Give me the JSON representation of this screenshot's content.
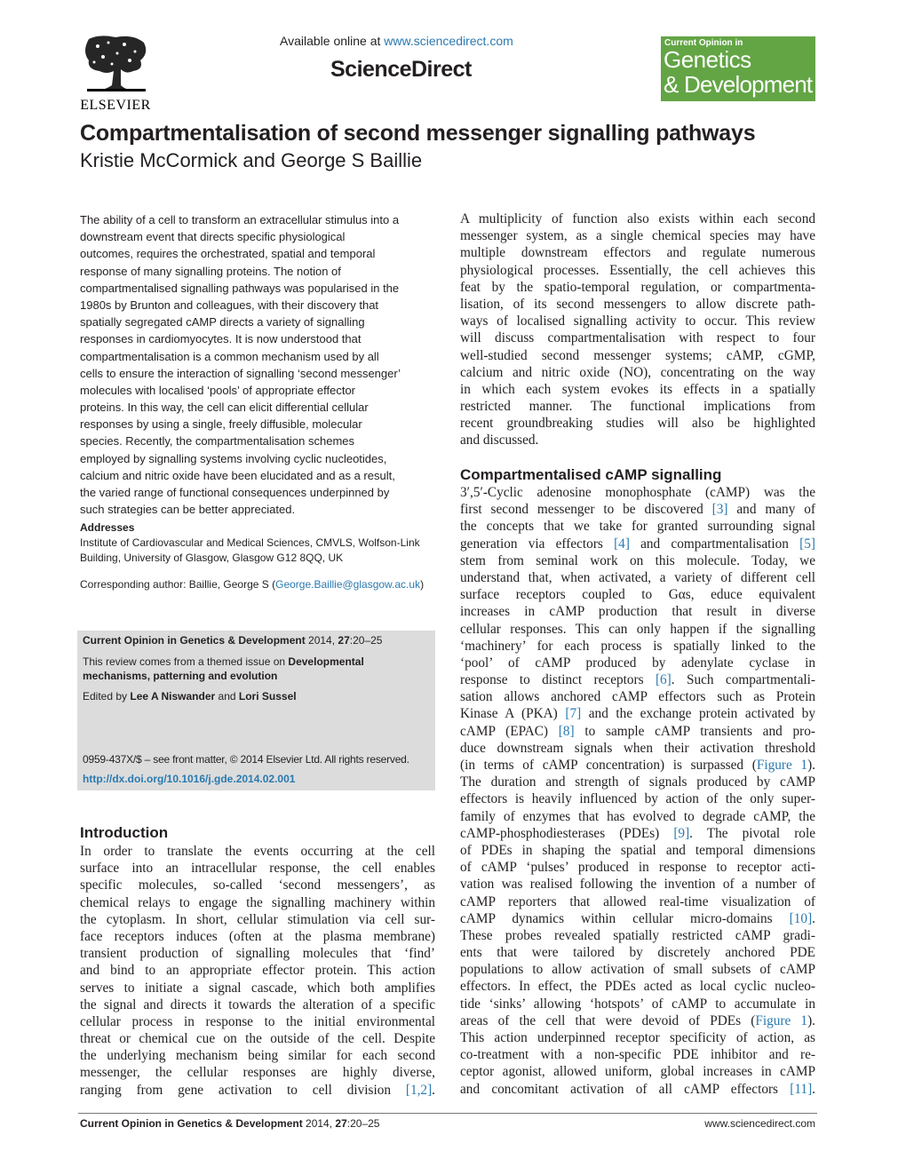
{
  "header": {
    "publisher_logo": "ELSEVIER",
    "available_online_prefix": "Available online at ",
    "available_online_link": "www.sciencedirect.com",
    "platform_name": "ScienceDirect",
    "journal_badge": {
      "top_line": "Current Opinion in",
      "line1": "Genetics",
      "line2": "& Development",
      "color": "#63a545"
    }
  },
  "article": {
    "title": "Compartmentalisation of second messenger signalling pathways",
    "authors": "Kristie McCormick and George S Baillie"
  },
  "abstract": {
    "lines": [
      "The ability of a cell to transform an extracellular stimulus into a",
      "downstream event that directs specific physiological",
      "outcomes, requires the orchestrated, spatial and temporal",
      "response of many signalling proteins. The notion of",
      "compartmentalised signalling pathways was popularised in the",
      "1980s by Brunton and colleagues, with their discovery that",
      "spatially segregated cAMP directs a variety of signalling",
      "responses in cardiomyocytes. It is now understood that",
      "compartmentalisation is a common mechanism used by all",
      "cells to ensure the interaction of signalling ‘second messenger’",
      "molecules with localised ‘pools’ of appropriate effector",
      "proteins. In this way, the cell can elicit differential cellular",
      "responses by using a single, freely diffusible, molecular",
      "species. Recently, the compartmentalisation schemes",
      "employed by signalling systems involving cyclic nucleotides,",
      "calcium and nitric oxide have been elucidated and as a result,",
      "the varied range of functional consequences underpinned by",
      "such strategies can be better appreciated."
    ]
  },
  "addresses": {
    "heading": "Addresses",
    "lines": [
      "Institute of Cardiovascular and Medical Sciences, CMVLS, Wolfson-Link",
      "Building, University of Glasgow, Glasgow G12 8QQ, UK"
    ],
    "corresponding_prefix": "Corresponding author: Baillie, George S (",
    "corresponding_email": "George.Baillie@glasgow.ac.uk",
    "corresponding_suffix": ")"
  },
  "info_box": {
    "journal": "Current Opinion in Genetics & Development",
    "year": " 2014, ",
    "volume": "27",
    "pages": ":20–25",
    "themed_prefix": "This review comes from a themed issue on ",
    "themed_issue_line1": "Developmental",
    "themed_issue_line2": "mechanisms, patterning and evolution",
    "edited_prefix": "Edited by ",
    "editor1": "Lee A Niswander",
    "editor_and": " and ",
    "editor2": "Lori Sussel",
    "copyright": "0959-437X/$ – see front matter, © 2014 Elsevier Ltd. All rights reserved.",
    "doi": "http://dx.doi.org/10.1016/j.gde.2014.02.001",
    "color": "#dcdcdc"
  },
  "introduction": {
    "heading": "Introduction",
    "lines": [
      "In order to translate the events occurring at the cell",
      "surface into an intracellular response, the cell enables",
      "specific molecules, so-called ‘second messengers’, as",
      "chemical relays to engage the signalling machinery within",
      "the cytoplasm. In short, cellular stimulation via cell sur-",
      "face receptors induces (often at the plasma membrane)",
      "transient production of signalling molecules that ‘find’",
      "and bind to an appropriate effector protein. This action",
      "serves to initiate a signal cascade, which both amplifies",
      "the signal and directs it towards the alteration of a specific",
      "cellular process in response to the initial environmental",
      "threat or chemical cue on the outside of the cell. Despite",
      "the underlying mechanism being similar for each second",
      "messenger, the cellular responses are highly diverse,",
      "ranging from gene activation to cell division "
    ],
    "last_ref": "[1,2]",
    "last_ref_suffix": "."
  },
  "right_intro": {
    "lines": [
      "A multiplicity of function also exists within each second",
      "messenger system, as a single chemical species may have",
      "multiple downstream effectors and regulate numerous",
      "physiological processes. Essentially, the cell achieves this",
      "feat by the spatio-temporal regulation, or compartmenta-",
      "lisation, of its second messengers to allow discrete path-",
      "ways of localised signalling activity to occur. This review",
      "will discuss compartmentalisation with respect to four",
      "well-studied second messenger systems; cAMP, cGMP,",
      "calcium and nitric oxide (NO), concentrating on the way",
      "in which each system evokes its effects in a spatially",
      "restricted manner. The functional implications from",
      "recent groundbreaking studies will also be highlighted",
      "and discussed."
    ]
  },
  "camp_section": {
    "heading": "Compartmentalised cAMP signalling",
    "lines": [
      {
        "t": "3′,5′-Cyclic adenosine monophosphate (cAMP) was the"
      },
      {
        "t": "first second messenger to be discovered ",
        "ref": "[3]",
        "after": " and many of"
      },
      {
        "t": "the concepts that we take for granted surrounding signal"
      },
      {
        "t": "generation via effectors ",
        "ref": "[4]",
        "after": " and compartmentalisation ",
        "ref2": "[5]"
      },
      {
        "t": "stem from seminal work on this molecule. Today, we"
      },
      {
        "t": "understand that, when activated, a variety of different cell"
      },
      {
        "t": "surface receptors coupled to Gαs, educe equivalent"
      },
      {
        "t": "increases in cAMP production that result in diverse"
      },
      {
        "t": "cellular responses. This can only happen if the signalling"
      },
      {
        "t": "‘machinery’ for each process is spatially linked to the"
      },
      {
        "t": "‘pool’ of cAMP produced by adenylate cyclase in"
      },
      {
        "t": "response to distinct receptors ",
        "ref": "[6]",
        "after": ". Such compartmentali-"
      },
      {
        "t": "sation allows anchored cAMP effectors such as Protein"
      },
      {
        "t": "Kinase A (PKA) ",
        "ref": "[7]",
        "after": " and the exchange protein activated by"
      },
      {
        "t": "cAMP (EPAC) ",
        "ref": "[8]",
        "after": " to sample cAMP transients and pro-"
      },
      {
        "t": "duce downstream signals when their activation threshold"
      },
      {
        "t": "(in terms of cAMP concentration) is surpassed (",
        "ref": "Figure 1",
        "after": ")."
      },
      {
        "t": "The duration and strength of signals produced by cAMP"
      },
      {
        "t": "effectors is heavily influenced by action of the only super-"
      },
      {
        "t": "family of enzymes that has evolved to degrade cAMP, the"
      },
      {
        "t": "cAMP-phosphodiesterases (PDEs) ",
        "ref": "[9]",
        "after": ". The pivotal role"
      },
      {
        "t": "of PDEs in shaping the spatial and temporal dimensions"
      },
      {
        "t": "of cAMP ‘pulses’ produced in response to receptor acti-"
      },
      {
        "t": "vation was realised following the invention of a number of"
      },
      {
        "t": "cAMP reporters that allowed real-time visualization of"
      },
      {
        "t": "cAMP dynamics within cellular micro-domains ",
        "ref": "[10]",
        "after": "."
      },
      {
        "t": "These probes revealed spatially restricted cAMP gradi-"
      },
      {
        "t": "ents that were tailored by discretely anchored PDE"
      },
      {
        "t": "populations to allow activation of small subsets of cAMP"
      },
      {
        "t": "effectors. In effect, the PDEs acted as local cyclic nucleo-"
      },
      {
        "t": "tide ‘sinks’ allowing ‘hotspots’ of cAMP to accumulate in"
      },
      {
        "t": "areas of the cell that were devoid of PDEs (",
        "ref": "Figure 1",
        "after": ")."
      },
      {
        "t": "This action underpinned receptor specificity of action, as"
      },
      {
        "t": "co-treatment with a non-specific PDE inhibitor and re-"
      },
      {
        "t": "ceptor agonist, allowed uniform, global increases in cAMP"
      },
      {
        "t": "and concomitant activation of all cAMP effectors ",
        "ref": "[11]",
        "after": "."
      }
    ]
  },
  "footer": {
    "journal": "Current Opinion in Genetics & Development",
    "year": " 2014, ",
    "volume": "27",
    "pages": ":20–25",
    "site": "www.sciencedirect.com"
  },
  "colors": {
    "link": "#2a7ab0",
    "text": "#231f20"
  }
}
